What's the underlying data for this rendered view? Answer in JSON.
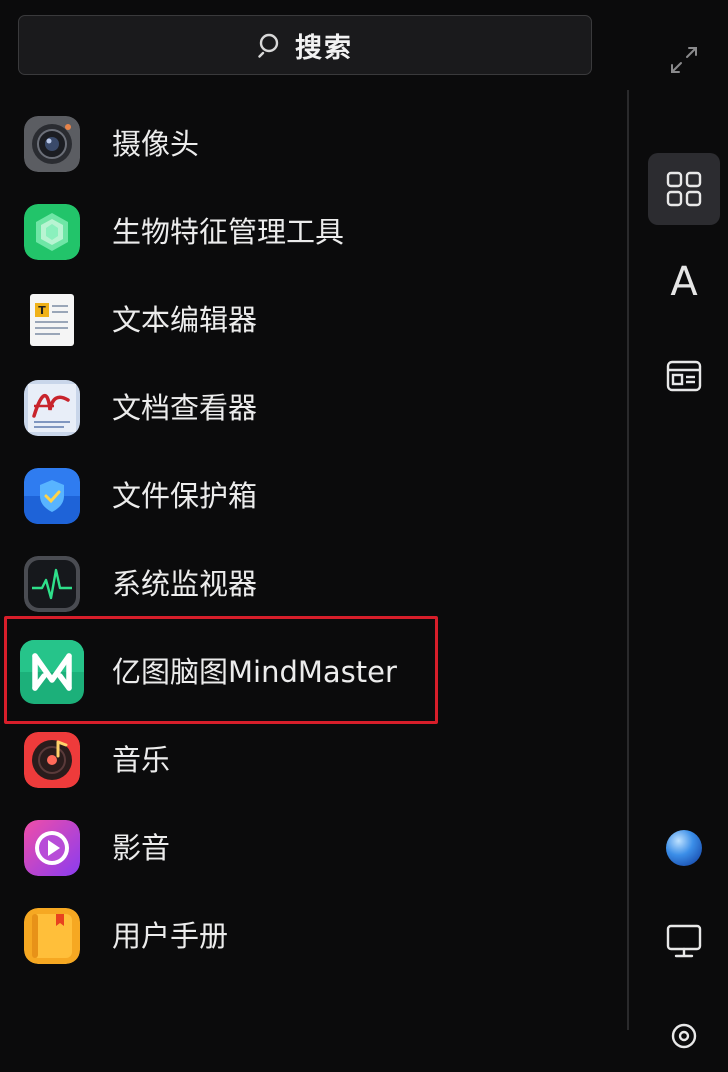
{
  "search": {
    "label": "搜索"
  },
  "apps": [
    {
      "name": "摄像头",
      "icon": "camera-icon"
    },
    {
      "name": "生物特征管理工具",
      "icon": "biometric-icon"
    },
    {
      "name": "文本编辑器",
      "icon": "text-editor-icon"
    },
    {
      "name": "文档查看器",
      "icon": "document-viewer-icon"
    },
    {
      "name": "文件保护箱",
      "icon": "file-protection-icon"
    },
    {
      "name": "系统监视器",
      "icon": "system-monitor-icon"
    },
    {
      "name": "亿图脑图MindMaster",
      "icon": "mindmaster-icon"
    },
    {
      "name": "音乐",
      "icon": "music-icon"
    },
    {
      "name": "影音",
      "icon": "video-icon"
    },
    {
      "name": "用户手册",
      "icon": "user-manual-icon"
    }
  ],
  "sidebar": {
    "font_button": {
      "glyph": "A"
    }
  },
  "colors": {
    "highlight": "#d81e2a",
    "background": "#0b0b0c"
  }
}
